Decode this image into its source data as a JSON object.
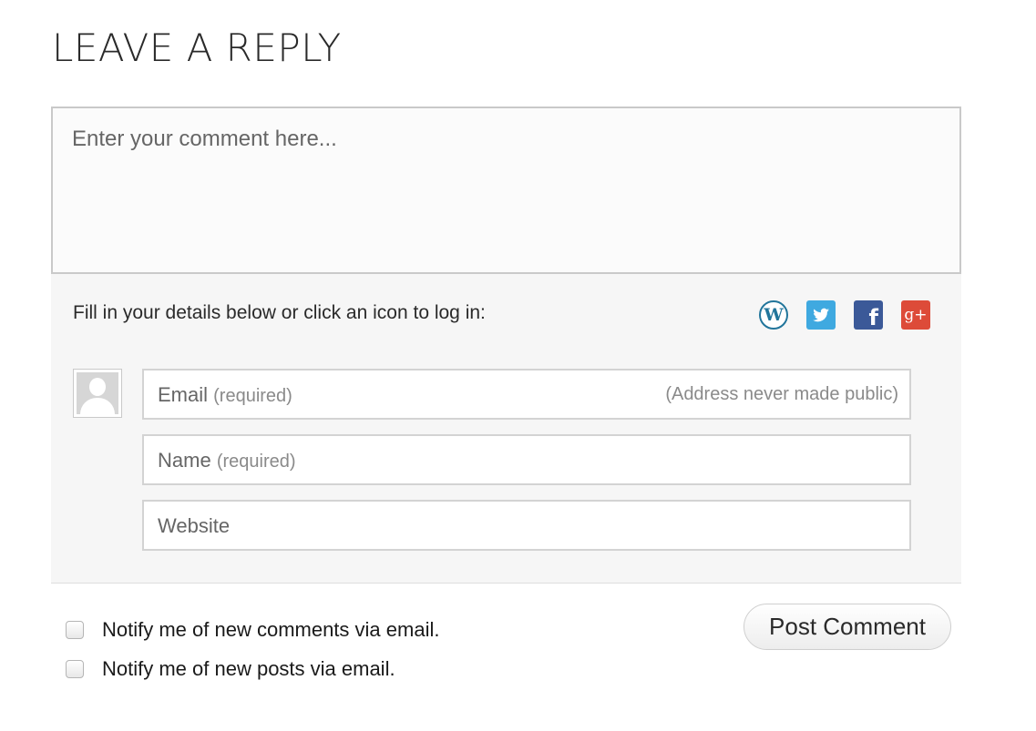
{
  "heading": "LEAVE A REPLY",
  "comment": {
    "placeholder": "Enter your comment here...",
    "value": ""
  },
  "details": {
    "prompt": "Fill in your details below or click an icon to log in:",
    "login_icons": [
      {
        "name": "wordpress-icon",
        "glyph": "W",
        "color": "#21759b"
      },
      {
        "name": "twitter-icon",
        "color": "#3fa9e0"
      },
      {
        "name": "facebook-icon",
        "glyph": "f",
        "color": "#3b5998"
      },
      {
        "name": "google-plus-icon",
        "glyph": "g+",
        "color": "#dd4b39"
      }
    ],
    "email": {
      "label": "Email",
      "required": "(required)",
      "note": "(Address never made public)"
    },
    "name": {
      "label": "Name",
      "required": "(required)"
    },
    "website": {
      "label": "Website"
    }
  },
  "options": {
    "notify_comments": "Notify me of new comments via email.",
    "notify_posts": "Notify me of new posts via email."
  },
  "post_button": "Post Comment"
}
